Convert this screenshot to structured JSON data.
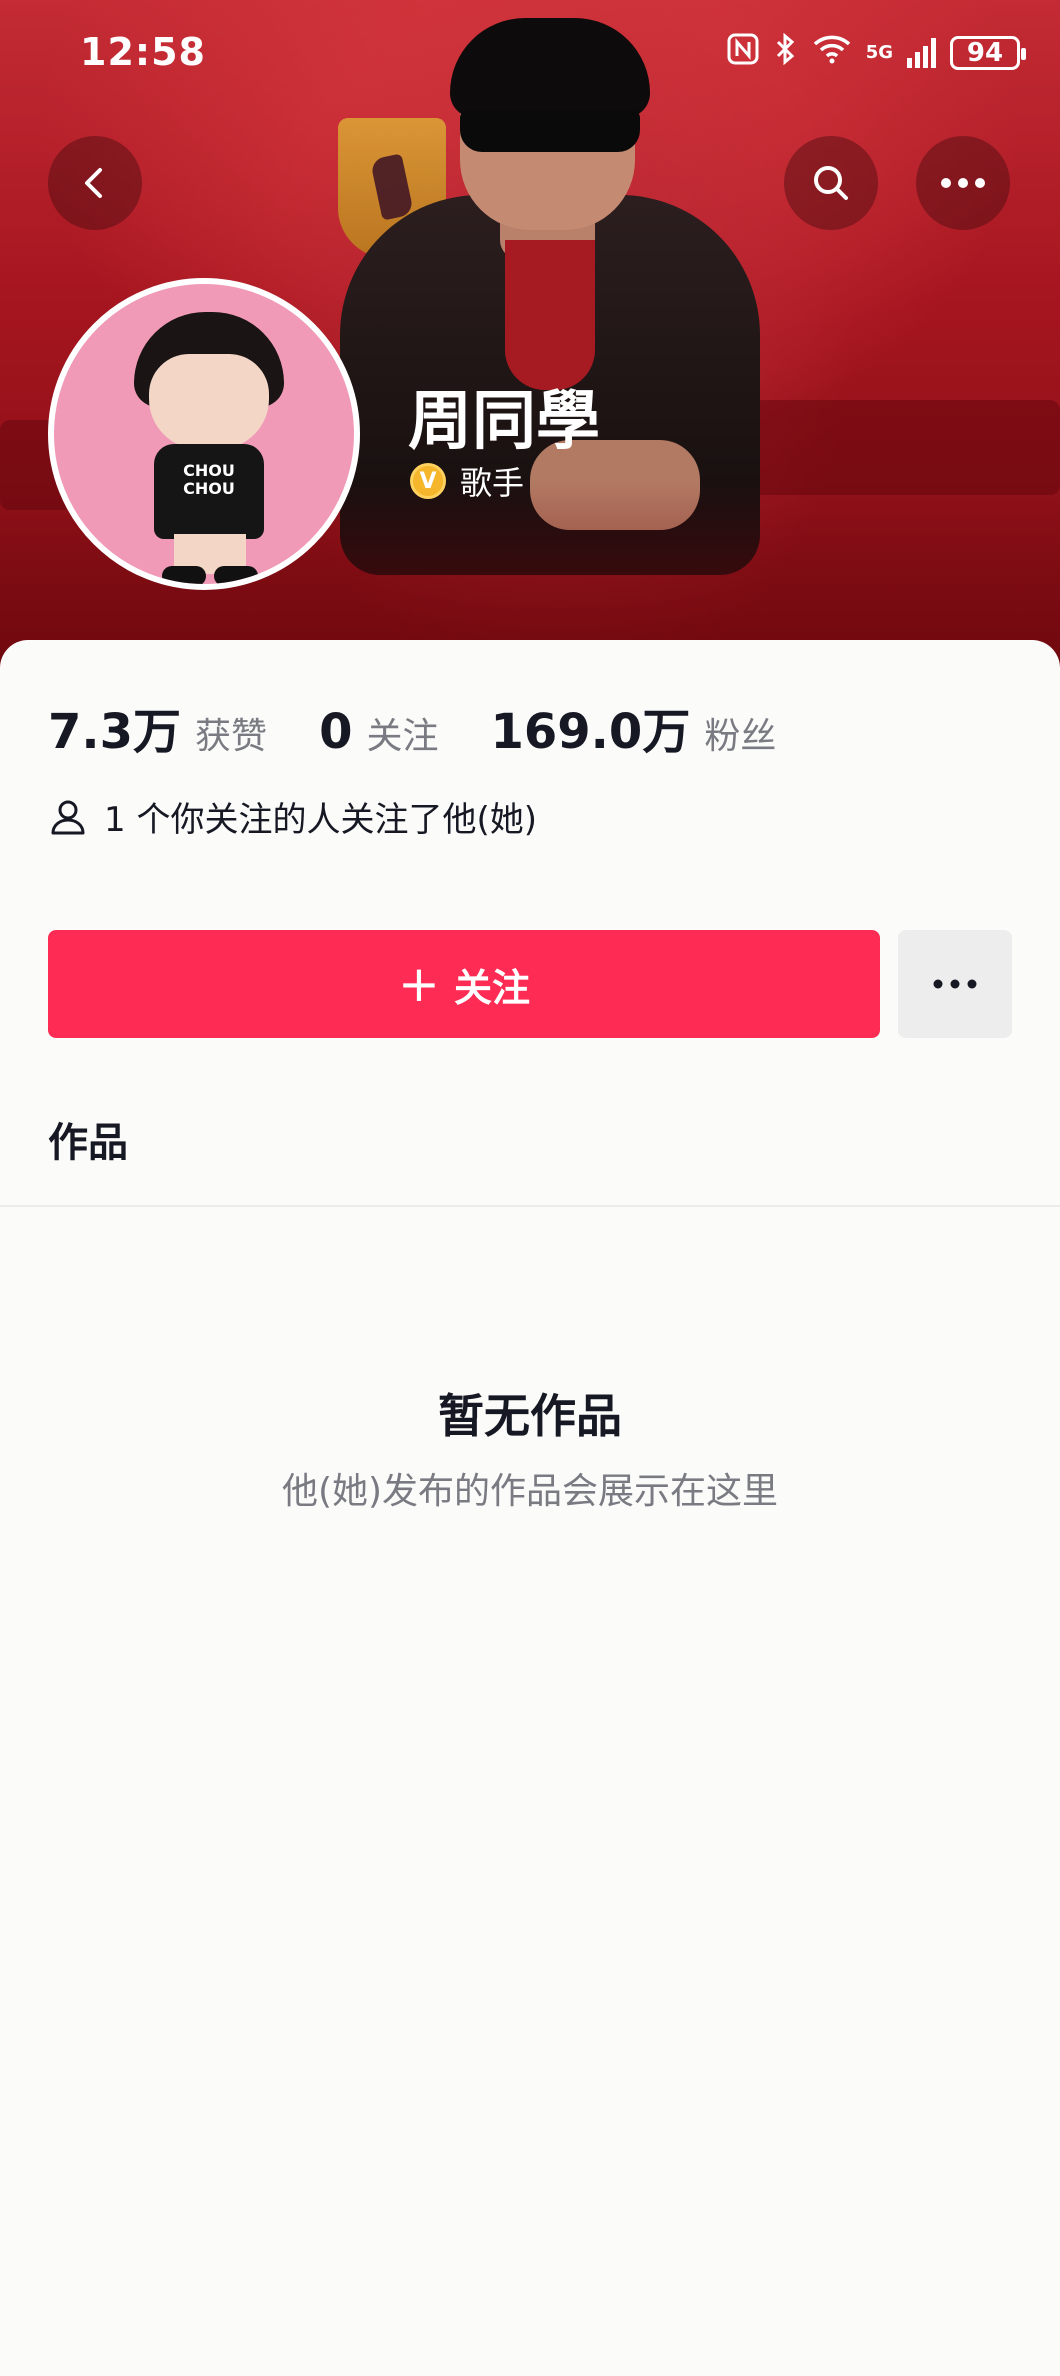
{
  "status_bar": {
    "time": "12:58",
    "battery": "94",
    "network": "5G"
  },
  "profile": {
    "name": "周同學",
    "verified_label": "歌手",
    "verified_badge_letter": "V",
    "avatar_logo_text": "CHOU CHOU"
  },
  "stats": {
    "likes_value": "7.3万",
    "likes_label": "获赞",
    "following_value": "0",
    "following_label": "关注",
    "followers_value": "169.0万",
    "followers_label": "粉丝"
  },
  "mutual_text": "1 个你关注的人关注了他(她)",
  "actions": {
    "follow_label": "关注",
    "follow_plus": "+"
  },
  "tabs": {
    "works_label": "作品"
  },
  "empty_state": {
    "title": "暂无作品",
    "subtitle": "他(她)发布的作品会展示在这里"
  },
  "colors": {
    "accent": "#fe2c55",
    "hero": "#a5151f"
  }
}
